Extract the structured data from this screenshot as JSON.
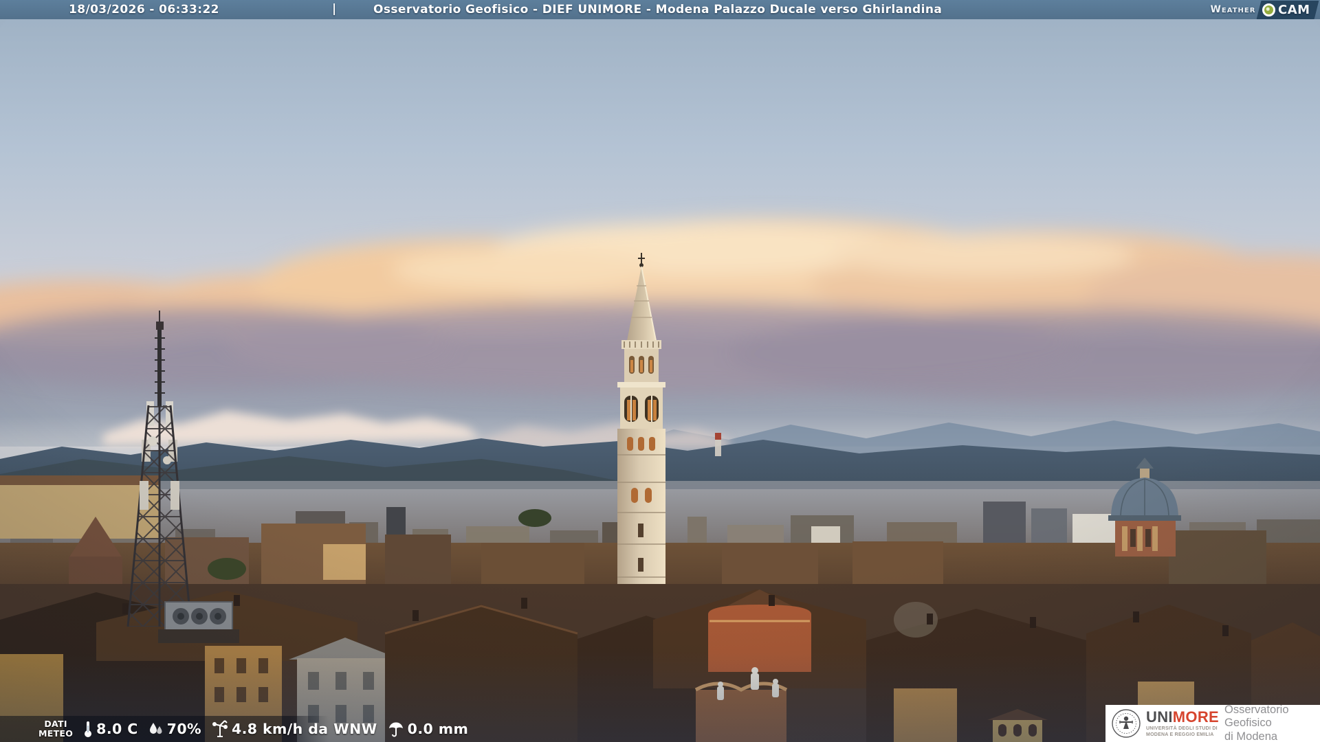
{
  "header": {
    "datetime": "18/03/2026 - 06:33:22",
    "separator": "|",
    "title": "Osservatorio Geofisico - DIEF UNIMORE - Modena Palazzo Ducale verso Ghirlandina",
    "logo": {
      "part1": "Weather",
      "part2": "CAM"
    }
  },
  "meteo": {
    "label_line1": "DATI",
    "label_line2": "METEO",
    "temperature": "8.0 C",
    "humidity": "70%",
    "wind": "4.8 km/h da WNW",
    "rain": "0.0 mm"
  },
  "branding": {
    "uni_part1": "UNI",
    "uni_part2": "MORE",
    "uni_sub1": "UNIVERSITÀ DEGLI STUDI DI",
    "uni_sub2": "MODENA E REGGIO EMILIA",
    "org_line1": "Osservatorio Geofisico",
    "org_line2": "di Modena"
  },
  "icons": {
    "temperature": "thermometer-icon",
    "humidity": "water-drops-icon",
    "wind": "anemometer-icon",
    "rain": "umbrella-icon",
    "logo_dot": "camera-lens-dot-icon"
  },
  "colors": {
    "topbar": "#577894",
    "overlay_text": "#ffffff",
    "unimore_red": "#d6452e",
    "unimore_grey": "#4d4d4f",
    "org_text_grey": "#8f8f92",
    "sky_top": "#a6b8cb",
    "cloud_orange": "#f2cda4",
    "mountain_blue": "#4c5f73"
  }
}
